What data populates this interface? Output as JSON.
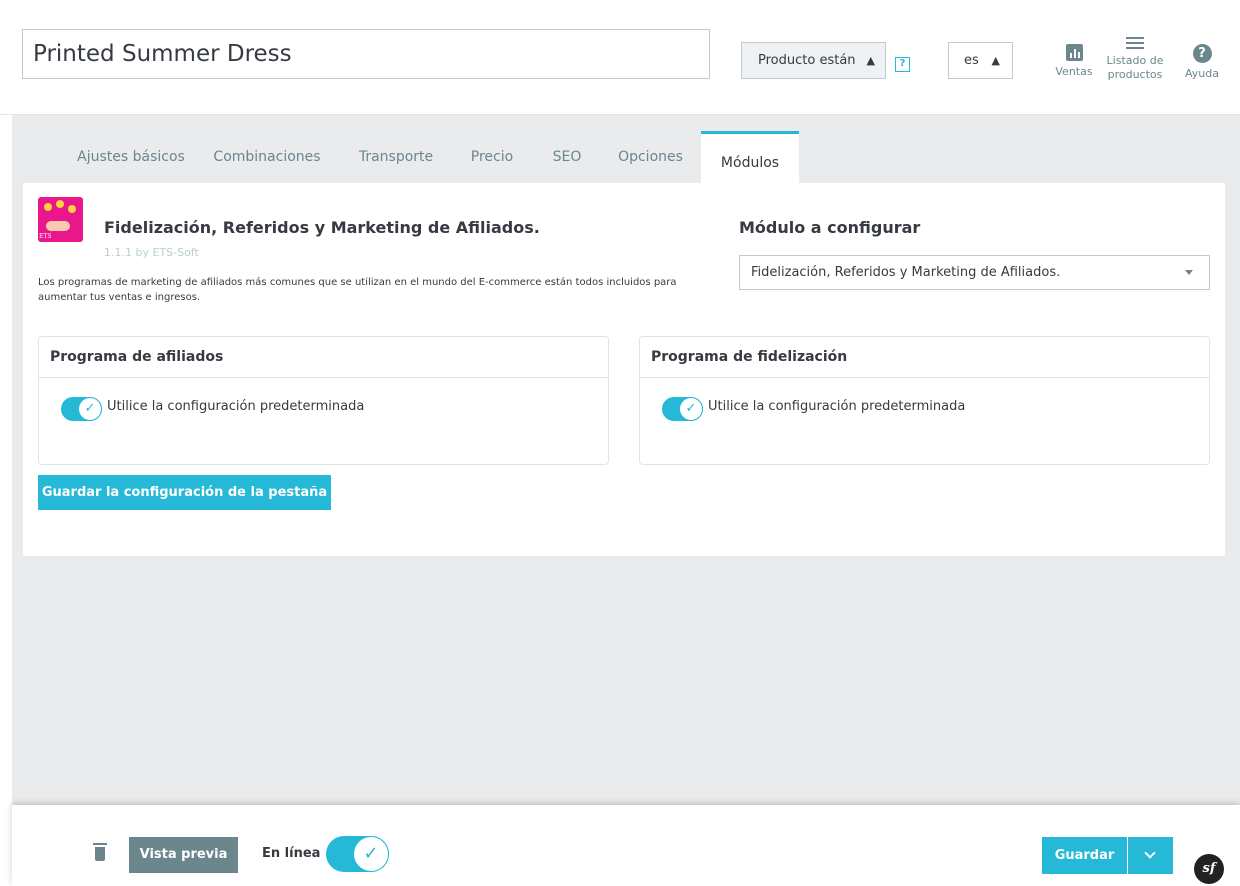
{
  "header": {
    "product_name": "Printed Summer Dress",
    "product_type": "Producto están",
    "help_mark": "?",
    "language": "es",
    "toolbar": {
      "sales_label": "Ventas",
      "product_list_label": "Listado de productos",
      "help_label": "Ayuda",
      "sales_icon": "chart-icon",
      "list_icon": "list-icon",
      "help_icon": "question-circle-icon"
    }
  },
  "tabs": [
    {
      "label": "Ajustes básicos",
      "active": false
    },
    {
      "label": "Combinaciones",
      "active": false
    },
    {
      "label": "Transporte",
      "active": false
    },
    {
      "label": "Precio",
      "active": false
    },
    {
      "label": "SEO",
      "active": false
    },
    {
      "label": "Opciones",
      "active": false
    },
    {
      "label": "Módulos",
      "active": true
    }
  ],
  "module": {
    "title": "Fidelización, Referidos y Marketing de Afiliados.",
    "version": "1.1.1 by ETS-Soft",
    "logo_text": "ETS",
    "description": "Los programas de marketing de afiliados más comunes que se utilizan en el mundo del E-commerce están todos incluidos para aumentar tus ventas e ingresos.",
    "configure_label": "Módulo a configurar",
    "configure_selected": "Fidelización, Referidos y Marketing de Afiliados."
  },
  "cards": {
    "affiliate": {
      "title": "Programa de afiliados",
      "toggle_label": "Utilice la configuración predeterminada",
      "toggle_on": true
    },
    "loyalty": {
      "title": "Programa de fidelización",
      "toggle_label": "Utilice la configuración predeterminada",
      "toggle_on": true
    }
  },
  "save_tab_label": "Guardar la configuración de la pestaña",
  "footer": {
    "preview_label": "Vista previa",
    "online_label": "En línea",
    "online_on": true,
    "save_label": "Guardar"
  },
  "colors": {
    "accent": "#25b9d7",
    "secondary": "#6c868e",
    "background": "#eaebec",
    "text": "#363a41"
  }
}
